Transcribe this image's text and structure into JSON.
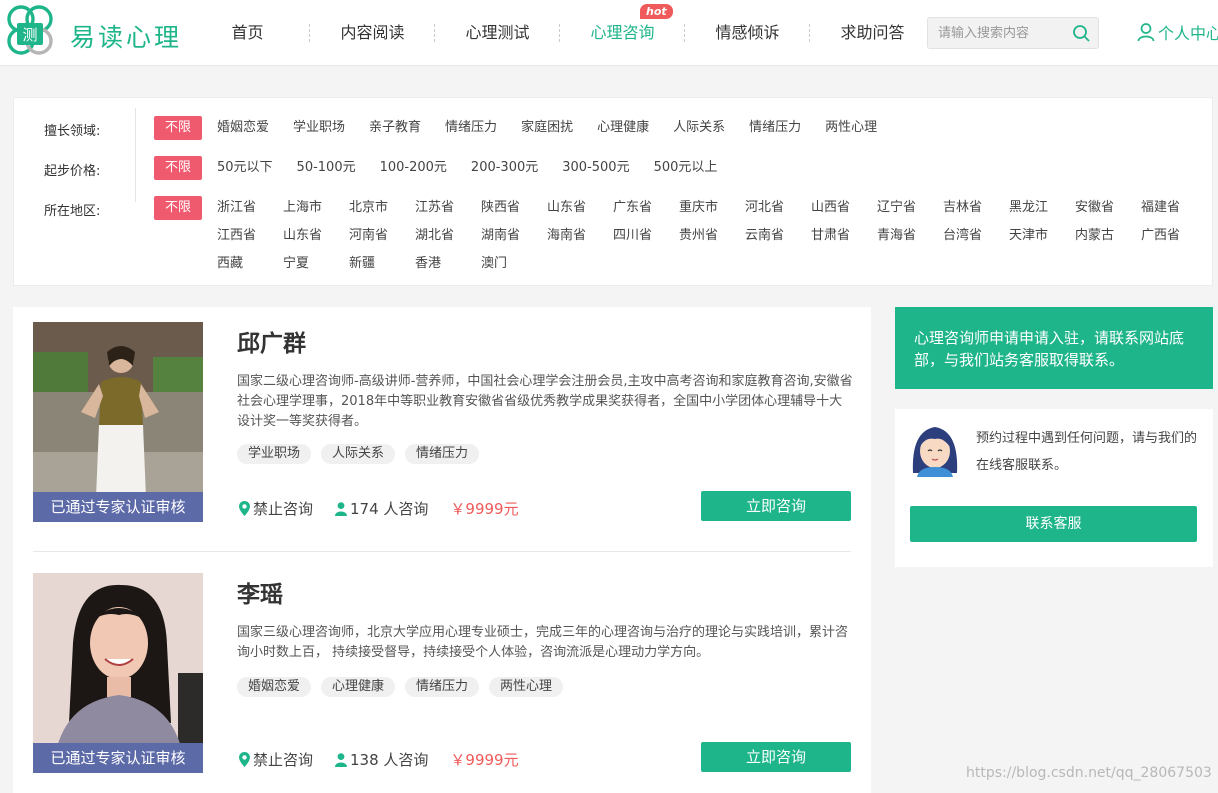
{
  "header": {
    "logo_text": "易读心理",
    "nav": [
      {
        "label": "首页"
      },
      {
        "label": "内容阅读"
      },
      {
        "label": "心理测试"
      },
      {
        "label": "心理咨询",
        "hot": "hot"
      },
      {
        "label": "情感倾诉"
      },
      {
        "label": "求助问答"
      }
    ],
    "search_placeholder": "请输入搜索内容",
    "user_center": "个人中心"
  },
  "filter": {
    "all_label": "不限",
    "rows": [
      {
        "label": "擅长领域:",
        "options": [
          "婚姻恋爱",
          "学业职场",
          "亲子教育",
          "情绪压力",
          "家庭困扰",
          "心理健康",
          "人际关系",
          "情绪压力",
          "两性心理"
        ]
      },
      {
        "label": "起步价格:",
        "options": [
          "50元以下",
          "50-100元",
          "100-200元",
          "200-300元",
          "300-500元",
          "500元以上"
        ]
      },
      {
        "label": "所在地区:",
        "options": [
          "浙江省",
          "上海市",
          "北京市",
          "江苏省",
          "陕西省",
          "山东省",
          "广东省",
          "重庆市",
          "河北省",
          "山西省",
          "辽宁省",
          "吉林省",
          "黑龙江",
          "安徽省",
          "福建省",
          "江西省",
          "山东省",
          "河南省",
          "湖北省",
          "湖南省",
          "海南省",
          "四川省",
          "贵州省",
          "云南省",
          "甘肃省",
          "青海省",
          "台湾省",
          "天津市",
          "内蒙古",
          "广西省",
          "西藏",
          "宁夏",
          "新疆",
          "香港",
          "澳门"
        ]
      }
    ]
  },
  "consultants": [
    {
      "name": "邱广群",
      "desc": "国家二级心理咨询师-高级讲师-营养师，中国社会心理学会注册会员,主攻中高考咨询和家庭教育咨询,安徽省社会心理学理事，2018年中等职业教育安徽省省级优秀教学成果奖获得者，全国中小学团体心理辅导十大设计奖一等奖获得者。",
      "tags": [
        "学业职场",
        "人际关系",
        "情绪压力"
      ],
      "badge": "已通过专家认证审核",
      "location": "禁止咨询",
      "count": "174 人咨询",
      "price": "￥9999元",
      "button": "立即咨询"
    },
    {
      "name": "李瑶",
      "desc": "国家三级心理咨询师，北京大学应用心理专业硕士，完成三年的心理咨询与治疗的理论与实践培训，累计咨询小时数上百， 持续接受督导，持续接受个人体验，咨询流派是心理动力学方向。",
      "tags": [
        "婚姻恋爱",
        "心理健康",
        "情绪压力",
        "两性心理"
      ],
      "badge": "已通过专家认证审核",
      "location": "禁止咨询",
      "count": "138 人咨询",
      "price": "￥9999元",
      "button": "立即咨询"
    }
  ],
  "sidebar": {
    "join_text": "心理咨询师申请申请入驻，请联系网站底部，与我们站务客服取得联系。",
    "service_text": "预约过程中遇到任何问题，请与我们的在线客服联系。",
    "contact_button": "联系客服"
  },
  "watermark": "https://blog.csdn.net/qq_28067503",
  "colors": {
    "accent": "#1fb58a",
    "hot": "#f05a5a",
    "badge": "#5d6aa8",
    "tag_all": "#f05a6e"
  }
}
